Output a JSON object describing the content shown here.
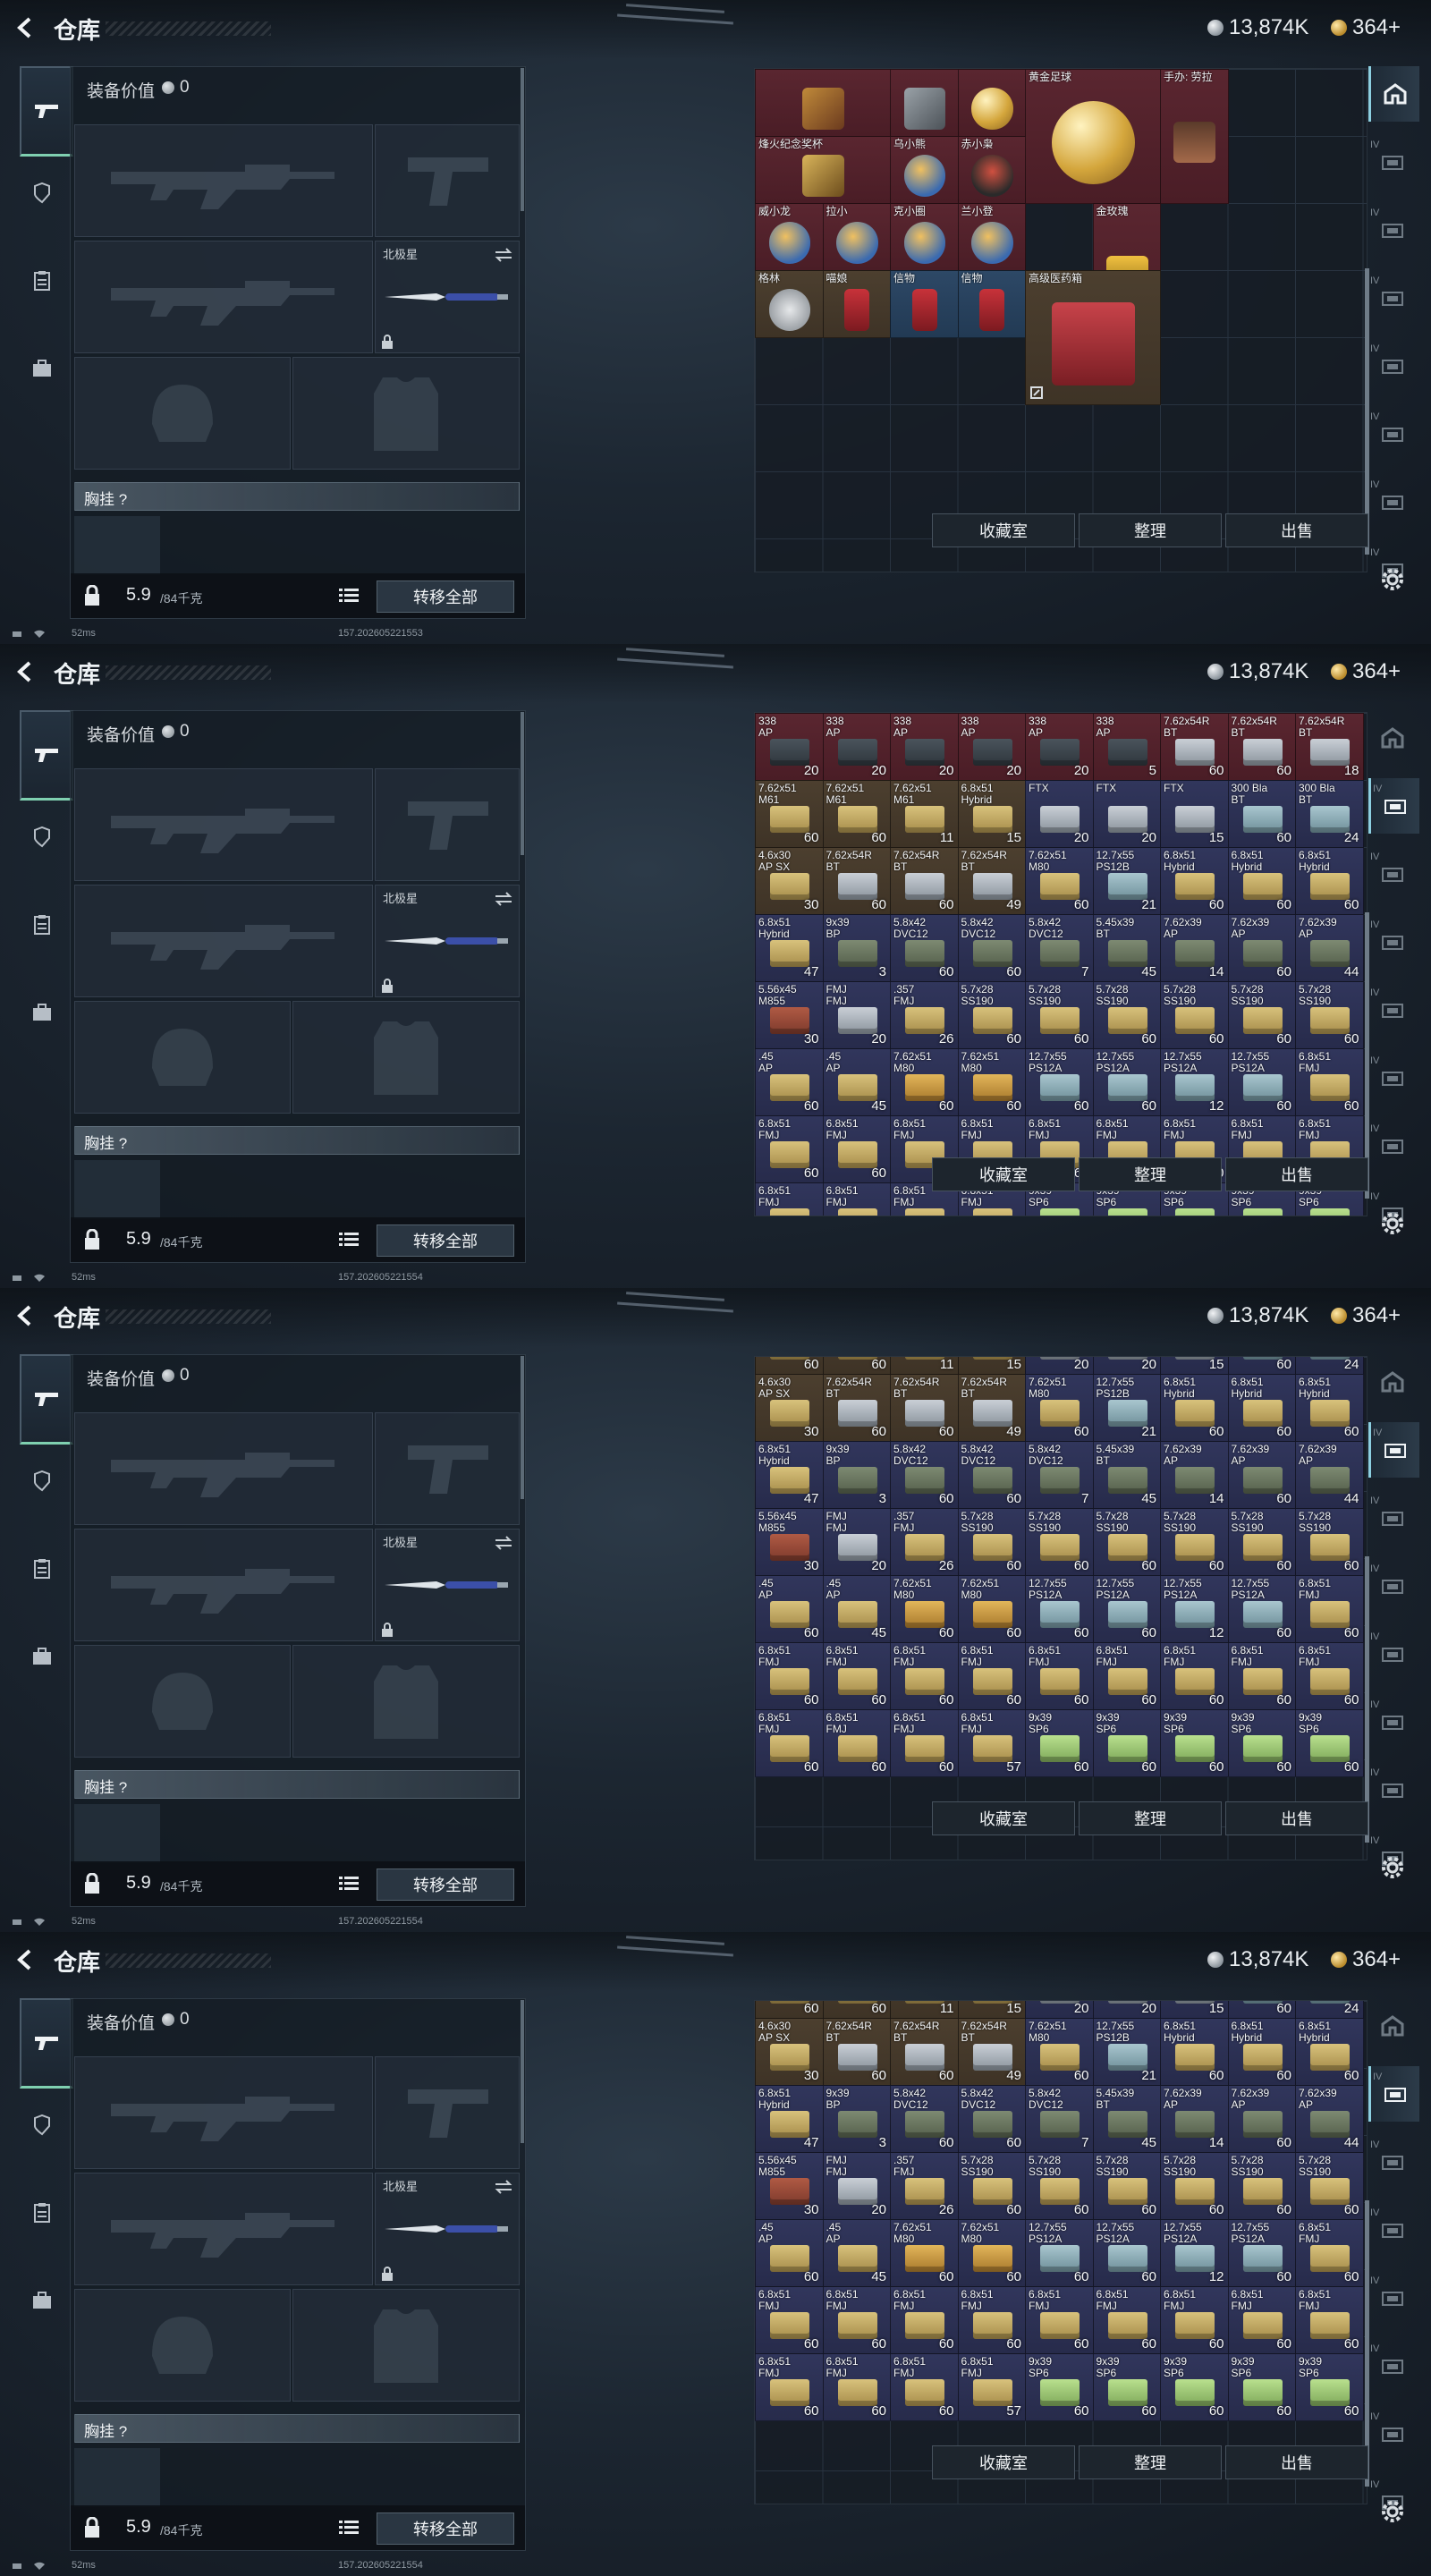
{
  "header": {
    "title": "仓库",
    "silver_amount": "13,874K",
    "gold_amount": "364+"
  },
  "loadout": {
    "value_label": "装备价值",
    "value": "0",
    "melee_name": "北极星",
    "rig_label": "胸挂 ?",
    "weight_current": "5.9",
    "weight_max": "/84千克",
    "transfer_all": "转移全部"
  },
  "status": [
    {
      "ping": "52ms",
      "build": "157.202605221553"
    },
    {
      "ping": "52ms",
      "build": "157.202605221554"
    },
    {
      "ping": "52ms",
      "build": "157.202605221554"
    },
    {
      "ping": "52ms",
      "build": "157.202605221554"
    }
  ],
  "actions": {
    "vault": "收藏室",
    "sort": "整理",
    "sell": "出售"
  },
  "rightnav": {
    "labels": [
      "IV",
      "IV",
      "IV",
      "IV",
      "IV",
      "IV",
      "IV",
      "IV"
    ]
  },
  "collectibles": [
    {
      "name": "",
      "row": 0,
      "col": 0,
      "w": 2,
      "h": 1,
      "color": "red",
      "art": "gold-statue"
    },
    {
      "name": "",
      "row": 0,
      "col": 2,
      "w": 1,
      "h": 1,
      "color": "red",
      "art": "mech"
    },
    {
      "name": "",
      "row": 0,
      "col": 3,
      "w": 1,
      "h": 1,
      "color": "red",
      "art": "gold-ball"
    },
    {
      "name": "黄金足球",
      "row": 0,
      "col": 4,
      "w": 2,
      "h": 2,
      "color": "red",
      "art": "gold-ball"
    },
    {
      "name": "手办: 劳拉",
      "row": 0,
      "col": 6,
      "w": 1,
      "h": 2,
      "color": "red",
      "art": "figure"
    },
    {
      "name": "烽火纪念奖杯",
      "row": 1,
      "col": 0,
      "w": 2,
      "h": 1,
      "color": "red",
      "art": "trophy"
    },
    {
      "name": "乌小熊",
      "row": 1,
      "col": 2,
      "w": 1,
      "h": 1,
      "color": "red",
      "art": "toy"
    },
    {
      "name": "赤小枭",
      "row": 1,
      "col": 3,
      "w": 1,
      "h": 1,
      "color": "red",
      "art": "hood"
    },
    {
      "name": "威小龙",
      "row": 2,
      "col": 0,
      "w": 1,
      "h": 1,
      "color": "red",
      "art": "toy"
    },
    {
      "name": "拉小",
      "row": 2,
      "col": 1,
      "w": 1,
      "h": 1,
      "color": "red",
      "art": "toy"
    },
    {
      "name": "克小圈",
      "row": 2,
      "col": 2,
      "w": 1,
      "h": 1,
      "color": "red",
      "art": "toy"
    },
    {
      "name": "兰小登",
      "row": 2,
      "col": 3,
      "w": 1,
      "h": 1,
      "color": "red",
      "art": "toy"
    },
    {
      "name": "金玫瑰",
      "row": 2,
      "col": 5,
      "w": 1,
      "h": 2,
      "color": "red",
      "art": "rose"
    },
    {
      "name": "格林",
      "row": 3,
      "col": 0,
      "w": 1,
      "h": 1,
      "color": "brown",
      "art": "disc"
    },
    {
      "name": "喵娘",
      "row": 3,
      "col": 1,
      "w": 1,
      "h": 1,
      "color": "brown",
      "art": "card"
    },
    {
      "name": "信物",
      "row": 3,
      "col": 2,
      "w": 1,
      "h": 1,
      "color": "blue",
      "art": "card"
    },
    {
      "name": "信物",
      "row": 3,
      "col": 3,
      "w": 1,
      "h": 1,
      "color": "blue",
      "art": "card"
    },
    {
      "name": "高级医药箱",
      "row": 3,
      "col": 4,
      "w": 2,
      "h": 2,
      "color": "brown",
      "art": "medkit"
    }
  ],
  "ammo_full": [
    {
      "name": "338\nAP",
      "count": 20,
      "color": "red",
      "box": "dk"
    },
    {
      "name": "338\nAP",
      "count": 20,
      "color": "red",
      "box": "dk"
    },
    {
      "name": "338\nAP",
      "count": 20,
      "color": "red",
      "box": "dk"
    },
    {
      "name": "338\nAP",
      "count": 20,
      "color": "red",
      "box": "dk"
    },
    {
      "name": "338\nAP",
      "count": 20,
      "color": "red",
      "box": "dk"
    },
    {
      "name": "338\nAP",
      "count": 5,
      "color": "red",
      "box": "dk"
    },
    {
      "name": "7.62x54R\nBT",
      "count": 60,
      "color": "red",
      "box": "wh"
    },
    {
      "name": "7.62x54R\nBT",
      "count": 60,
      "color": "red",
      "box": "wh"
    },
    {
      "name": "7.62x54R\nBT",
      "count": 18,
      "color": "red",
      "box": "wh"
    },
    {
      "name": "7.62x51\nM61",
      "count": 60,
      "color": "brown",
      "box": "ok"
    },
    {
      "name": "7.62x51\nM61",
      "count": 60,
      "color": "brown",
      "box": "ok"
    },
    {
      "name": "7.62x51\nM61",
      "count": 11,
      "color": "brown",
      "box": "ok"
    },
    {
      "name": "6.8x51\nHybrid",
      "count": 15,
      "color": "brown",
      "box": "ok"
    },
    {
      "name": "FTX",
      "count": 20,
      "color": "navy",
      "box": "wh"
    },
    {
      "name": "FTX",
      "count": 20,
      "color": "navy",
      "box": "wh"
    },
    {
      "name": "FTX",
      "count": 15,
      "color": "navy",
      "box": "wh"
    },
    {
      "name": "300 Bla\nBT",
      "count": 60,
      "color": "navy",
      "box": "bl"
    },
    {
      "name": "300 Bla\nBT",
      "count": 24,
      "color": "navy",
      "box": "bl"
    },
    {
      "name": "4.6x30\nAP SX",
      "count": 30,
      "color": "brown",
      "box": "ok"
    },
    {
      "name": "7.62x54R\nBT",
      "count": 60,
      "color": "brown",
      "box": "wh"
    },
    {
      "name": "7.62x54R\nBT",
      "count": 60,
      "color": "brown",
      "box": "wh"
    },
    {
      "name": "7.62x54R\nBT",
      "count": 49,
      "color": "brown",
      "box": "wh"
    },
    {
      "name": "7.62x51\nM80",
      "count": 60,
      "color": "navy",
      "box": "ok"
    },
    {
      "name": "12.7x55\nPS12B",
      "count": 21,
      "color": "navy",
      "box": "bl"
    },
    {
      "name": "6.8x51\nHybrid",
      "count": 60,
      "color": "navy",
      "box": "ok"
    },
    {
      "name": "6.8x51\nHybrid",
      "count": 60,
      "color": "navy",
      "box": "ok"
    },
    {
      "name": "6.8x51\nHybrid",
      "count": 60,
      "color": "navy",
      "box": "ok"
    },
    {
      "name": "6.8x51\nHybrid",
      "count": 47,
      "color": "navy",
      "box": "ok"
    },
    {
      "name": "9x39\nBP",
      "count": 3,
      "color": "navy",
      "box": "gr"
    },
    {
      "name": "5.8x42\nDVC12",
      "count": 60,
      "color": "navy",
      "box": "gr"
    },
    {
      "name": "5.8x42\nDVC12",
      "count": 60,
      "color": "navy",
      "box": "gr"
    },
    {
      "name": "5.8x42\nDVC12",
      "count": 7,
      "color": "navy",
      "box": "gr"
    },
    {
      "name": "5.45x39\nBT",
      "count": 45,
      "color": "navy",
      "box": "gr"
    },
    {
      "name": "7.62x39\nAP",
      "count": 14,
      "color": "navy",
      "box": "gr"
    },
    {
      "name": "7.62x39\nAP",
      "count": 60,
      "color": "navy",
      "box": "gr"
    },
    {
      "name": "7.62x39\nAP",
      "count": 44,
      "color": "navy",
      "box": "gr"
    },
    {
      "name": "5.56x45\nM855",
      "count": 30,
      "color": "navy",
      "box": "rd"
    },
    {
      "name": "FMJ\nFMJ",
      "count": 20,
      "color": "navy",
      "box": "wh"
    },
    {
      "name": ".357\nFMJ",
      "count": 26,
      "color": "navy",
      "box": "ok"
    },
    {
      "name": "5.7x28\nSS190",
      "count": 60,
      "color": "navy",
      "box": "ok"
    },
    {
      "name": "5.7x28\nSS190",
      "count": 60,
      "color": "navy",
      "box": "ok"
    },
    {
      "name": "5.7x28\nSS190",
      "count": 60,
      "color": "navy",
      "box": "ok"
    },
    {
      "name": "5.7x28\nSS190",
      "count": 60,
      "color": "navy",
      "box": "ok"
    },
    {
      "name": "5.7x28\nSS190",
      "count": 60,
      "color": "navy",
      "box": "ok"
    },
    {
      "name": "5.7x28\nSS190",
      "count": 60,
      "color": "navy",
      "box": "ok"
    },
    {
      "name": ".45\nAP",
      "count": 60,
      "color": "navy",
      "box": "ok"
    },
    {
      "name": ".45\nAP",
      "count": 45,
      "color": "navy",
      "box": "ok"
    },
    {
      "name": "7.62x51\nM80",
      "count": 60,
      "color": "navy",
      "box": "gd"
    },
    {
      "name": "7.62x51\nM80",
      "count": 60,
      "color": "navy",
      "box": "gd"
    },
    {
      "name": "12.7x55\nPS12A",
      "count": 60,
      "color": "navy",
      "box": "bl"
    },
    {
      "name": "12.7x55\nPS12A",
      "count": 60,
      "color": "navy",
      "box": "bl"
    },
    {
      "name": "12.7x55\nPS12A",
      "count": 12,
      "color": "navy",
      "box": "bl"
    },
    {
      "name": "12.7x55\nPS12A",
      "count": 60,
      "color": "navy",
      "box": "bl"
    },
    {
      "name": "6.8x51\nFMJ",
      "count": 60,
      "color": "navy",
      "box": "ok"
    },
    {
      "name": "6.8x51\nFMJ",
      "count": 60,
      "color": "navy",
      "box": "ok"
    },
    {
      "name": "6.8x51\nFMJ",
      "count": 60,
      "color": "navy",
      "box": "ok"
    },
    {
      "name": "6.8x51\nFMJ",
      "count": 60,
      "color": "navy",
      "box": "ok"
    },
    {
      "name": "6.8x51\nFMJ",
      "count": 60,
      "color": "navy",
      "box": "ok"
    },
    {
      "name": "6.8x51\nFMJ",
      "count": 60,
      "color": "navy",
      "box": "ok"
    },
    {
      "name": "6.8x51\nFMJ",
      "count": 60,
      "color": "navy",
      "box": "ok"
    },
    {
      "name": "6.8x51\nFMJ",
      "count": 60,
      "color": "navy",
      "box": "ok"
    },
    {
      "name": "6.8x51\nFMJ",
      "count": 60,
      "color": "navy",
      "box": "ok"
    },
    {
      "name": "6.8x51\nFMJ",
      "count": 60,
      "color": "navy",
      "box": "ok"
    },
    {
      "name": "6.8x51\nFMJ",
      "count": 60,
      "color": "navy",
      "box": "ok"
    },
    {
      "name": "6.8x51\nFMJ",
      "count": 60,
      "color": "navy",
      "box": "ok"
    },
    {
      "name": "6.8x51\nFMJ",
      "count": 60,
      "color": "navy",
      "box": "ok"
    },
    {
      "name": "6.8x51\nFMJ",
      "count": 57,
      "color": "navy",
      "box": "ok"
    },
    {
      "name": "9x39\nSP6",
      "count": 60,
      "color": "navy",
      "box": "lg"
    },
    {
      "name": "9x39\nSP6",
      "count": 60,
      "color": "navy",
      "box": "lg"
    },
    {
      "name": "9x39\nSP6",
      "count": 60,
      "color": "navy",
      "box": "lg"
    },
    {
      "name": "9x39\nSP6",
      "count": 60,
      "color": "navy",
      "box": "lg"
    },
    {
      "name": "9x39\nSP6",
      "count": 60,
      "color": "navy",
      "box": "lg"
    }
  ]
}
